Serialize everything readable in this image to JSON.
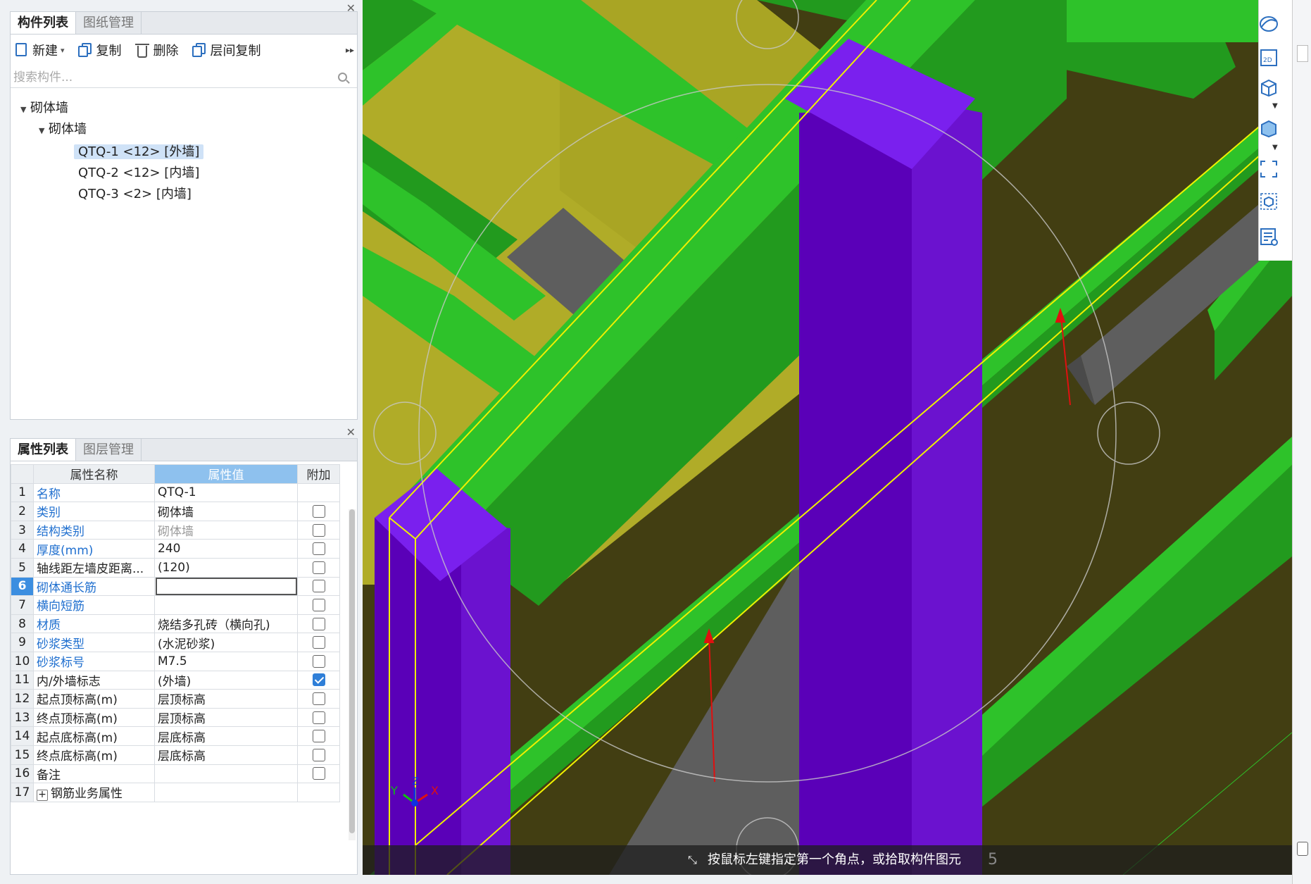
{
  "component_panel": {
    "tabs": [
      "构件列表",
      "图纸管理"
    ],
    "toolbar": {
      "new": "新建",
      "copy": "复制",
      "delete": "删除",
      "floor_copy": "层间复制"
    },
    "search_placeholder": "搜索构件...",
    "tree": {
      "root": "砌体墙",
      "group": "砌体墙",
      "items": [
        "QTQ-1 <12> [外墙]",
        "QTQ-2 <12> [内墙]",
        "QTQ-3 <2> [内墙]"
      ]
    }
  },
  "property_panel": {
    "tabs": [
      "属性列表",
      "图层管理"
    ],
    "headers": {
      "name": "属性名称",
      "value": "属性值",
      "extra": "附加"
    },
    "rows": [
      {
        "idx": "1",
        "name": "名称",
        "value": "QTQ-1",
        "check": null
      },
      {
        "idx": "2",
        "name": "类别",
        "value": "砌体墙",
        "check": false
      },
      {
        "idx": "3",
        "name": "结构类别",
        "value": "砌体墙",
        "check": false
      },
      {
        "idx": "4",
        "name": "厚度(mm)",
        "value": "240",
        "check": false
      },
      {
        "idx": "5",
        "name": "轴线距左墙皮距离...",
        "value": "(120)",
        "check": false
      },
      {
        "idx": "6",
        "name": "砌体通长筋",
        "value": "",
        "check": false
      },
      {
        "idx": "7",
        "name": "横向短筋",
        "value": "",
        "check": false
      },
      {
        "idx": "8",
        "name": "材质",
        "value": "烧结多孔砖（横向孔)",
        "check": false
      },
      {
        "idx": "9",
        "name": "砂浆类型",
        "value": "(水泥砂浆)",
        "check": false
      },
      {
        "idx": "10",
        "name": "砂浆标号",
        "value": "M7.5",
        "check": false
      },
      {
        "idx": "11",
        "name": "内/外墙标志",
        "value": "(外墙)",
        "check": true
      },
      {
        "idx": "12",
        "name": "起点顶标高(m)",
        "value": "层顶标高",
        "check": false
      },
      {
        "idx": "13",
        "name": "终点顶标高(m)",
        "value": "层顶标高",
        "check": false
      },
      {
        "idx": "14",
        "name": "起点底标高(m)",
        "value": "层底标高",
        "check": false
      },
      {
        "idx": "15",
        "name": "终点底标高(m)",
        "value": "层底标高",
        "check": false
      },
      {
        "idx": "16",
        "name": "备注",
        "value": "",
        "check": false
      },
      {
        "idx": "17",
        "name": "钢筋业务属性",
        "value": "",
        "check": null
      }
    ]
  },
  "viewport": {
    "status_text": "按鼠标左键指定第一个角点，或拾取构件图元",
    "status_number": "5",
    "axis_labels": {
      "x": "X",
      "y": "Y",
      "z": "Z"
    },
    "right_tools": [
      "orbit-icon",
      "2d-view-icon",
      "cube-view-icon",
      "cube-solid-icon",
      "fit-view-icon",
      "isometric-icon",
      "layer-list-icon"
    ],
    "colors": {
      "beam": "#2ec22a",
      "column": "#5a00b8",
      "slab": "#b0ac28",
      "wall": "#423e12",
      "selection": "#f0f000",
      "lintel": "#5e5e5e",
      "arrow": "#e01010"
    }
  }
}
